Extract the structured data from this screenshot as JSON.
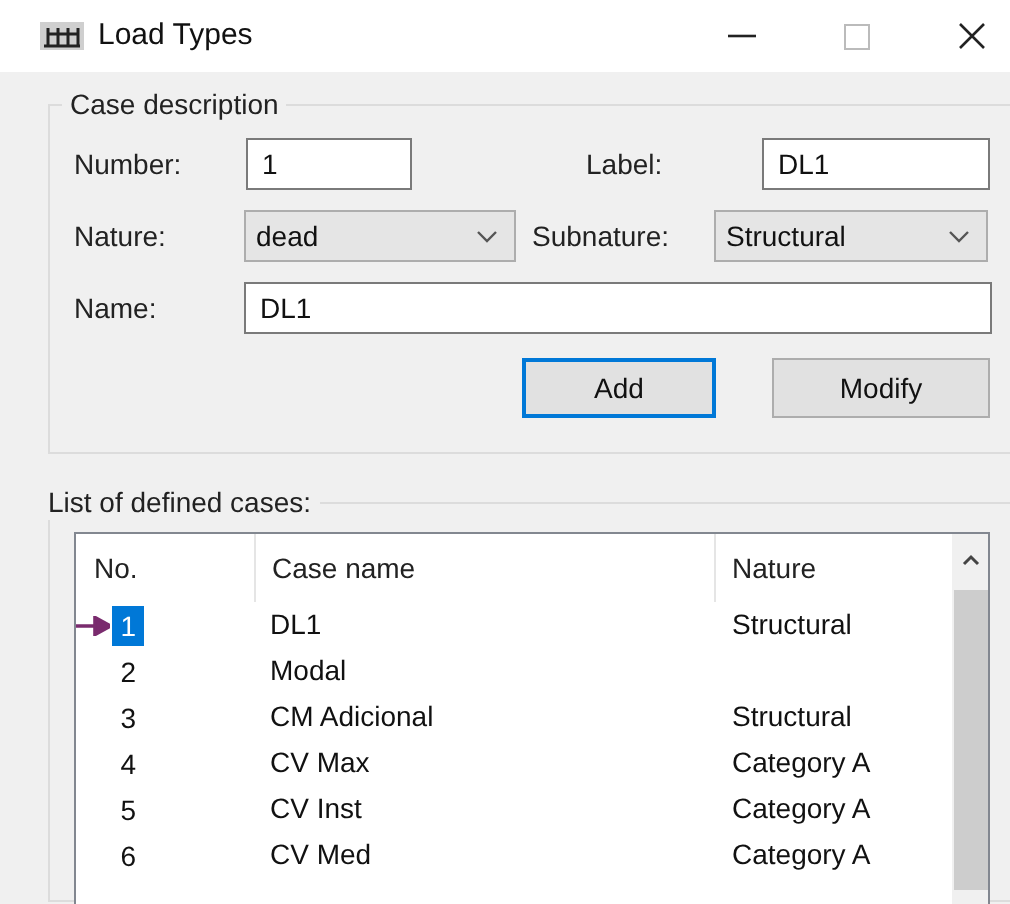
{
  "window": {
    "title": "Load Types"
  },
  "case_description": {
    "title": "Case description",
    "number": {
      "label": "Number:",
      "value": "1"
    },
    "label": {
      "label": "Label:",
      "value": "DL1"
    },
    "nature": {
      "label": "Nature:",
      "value": "dead"
    },
    "subnature": {
      "label": "Subnature:",
      "value": "Structural"
    },
    "name": {
      "label": "Name:",
      "value": "DL1"
    },
    "buttons": [
      {
        "label": "Add",
        "focused": true
      },
      {
        "label": "Modify",
        "focused": false
      }
    ]
  },
  "cases": {
    "title": "List of defined cases:",
    "columns": [
      "No.",
      "Case name",
      "Nature"
    ],
    "rows": [
      {
        "no": "1",
        "name": "DL1",
        "nature": "Structural",
        "selected": true
      },
      {
        "no": "2",
        "name": "Modal",
        "nature": "",
        "selected": false
      },
      {
        "no": "3",
        "name": "CM Adicional",
        "nature": "Structural",
        "selected": false
      },
      {
        "no": "4",
        "name": "CV Max",
        "nature": "Category A",
        "selected": false
      },
      {
        "no": "5",
        "name": "CV Inst",
        "nature": "Category A",
        "selected": false
      },
      {
        "no": "6",
        "name": "CV Med",
        "nature": "Category A",
        "selected": false
      }
    ]
  }
}
